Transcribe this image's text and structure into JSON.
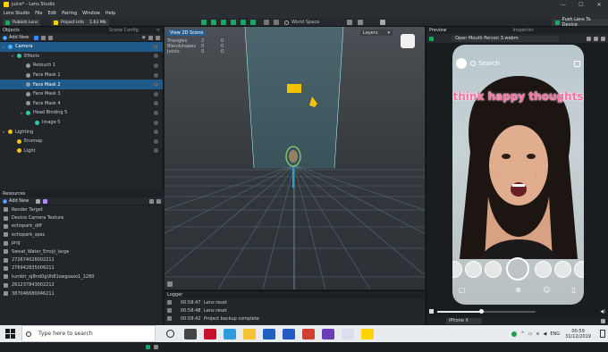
{
  "window": {
    "title": "juice* - Lens Studio",
    "min": "—",
    "max": "☐",
    "close": "✕"
  },
  "menu": [
    "Lens Studio",
    "File",
    "Edit",
    "Pairing",
    "Window",
    "Help"
  ],
  "toolbar": {
    "publish": "Publish Lens",
    "project_info": "Project Info",
    "size": "1.63 Mb",
    "world_space": "World Space",
    "push": "Push Lens To Device"
  },
  "objects_panel": {
    "title": "Objects",
    "tab2": "Scene Config",
    "add_new": "Add New",
    "items": [
      {
        "label": "Camera",
        "depth": 0,
        "selected": true,
        "icon_color": "#4ab0ff",
        "expanded": true
      },
      {
        "label": "Effects",
        "depth": 1,
        "selected": false,
        "icon_color": "#2ec7b0",
        "expanded": true
      },
      {
        "label": "Retouch 1",
        "depth": 2,
        "selected": false,
        "icon_color": "#8f9aa5"
      },
      {
        "label": "Face Mask 1",
        "depth": 2,
        "selected": false,
        "icon_color": "#8f9aa5"
      },
      {
        "label": "Face Mask 2",
        "depth": 2,
        "selected": true,
        "icon_color": "#8f9aa5"
      },
      {
        "label": "Face Mask 3",
        "depth": 2,
        "selected": false,
        "icon_color": "#8f9aa5"
      },
      {
        "label": "Face Mask 4",
        "depth": 2,
        "selected": false,
        "icon_color": "#8f9aa5"
      },
      {
        "label": "Head Binding 5",
        "depth": 2,
        "selected": false,
        "icon_color": "#2ec7b0",
        "expanded": true
      },
      {
        "label": "Image 5",
        "depth": 3,
        "selected": false,
        "icon_color": "#2ec7b0"
      },
      {
        "label": "Lighting",
        "depth": 0,
        "selected": false,
        "icon_color": "#f0c419",
        "expanded": true
      },
      {
        "label": "Envmap",
        "depth": 1,
        "selected": false,
        "icon_color": "#f0c419"
      },
      {
        "label": "Light",
        "depth": 1,
        "selected": false,
        "icon_color": "#f0c419"
      }
    ]
  },
  "resources_panel": {
    "title": "Resources",
    "add_new": "Add New",
    "items": [
      "Render Target",
      "Device Camera Texture",
      "echopark_diff",
      "echopark_spec",
      "png",
      "Sweat_Water_Emoji_large",
      "272674026002211",
      "276942835006211",
      "tumblr_oj8nd0gUh81swgsaxo1_1280",
      "261237843002212",
      "387046680046211"
    ]
  },
  "viewport": {
    "view_2d": "View 2D Scene",
    "layers": "Layers",
    "stats": [
      {
        "name": "Triangles",
        "v1": "2",
        "v2": "0"
      },
      {
        "name": "Blendshapes",
        "v1": "0",
        "v2": "0"
      },
      {
        "name": "Joints",
        "v1": "0",
        "v2": "0"
      }
    ]
  },
  "logger": {
    "title": "Logger",
    "rows": [
      {
        "time": "00:58:47",
        "msg": "Lens reset"
      },
      {
        "time": "00:58:48",
        "msg": "Lens reset"
      },
      {
        "time": "00:59:42",
        "msg": "Project backup complete"
      }
    ]
  },
  "preview": {
    "title": "Preview",
    "tab2": "Inspector",
    "video": "Open Mouth Person 3.webm",
    "search": "Search",
    "overlay_text": "think happy thoughts",
    "device": "iPhone X",
    "progress": 0.45
  },
  "taskbar": {
    "search_placeholder": "Type here to search",
    "time": "00:59",
    "date": "31/12/2019",
    "lang": "ENG"
  }
}
